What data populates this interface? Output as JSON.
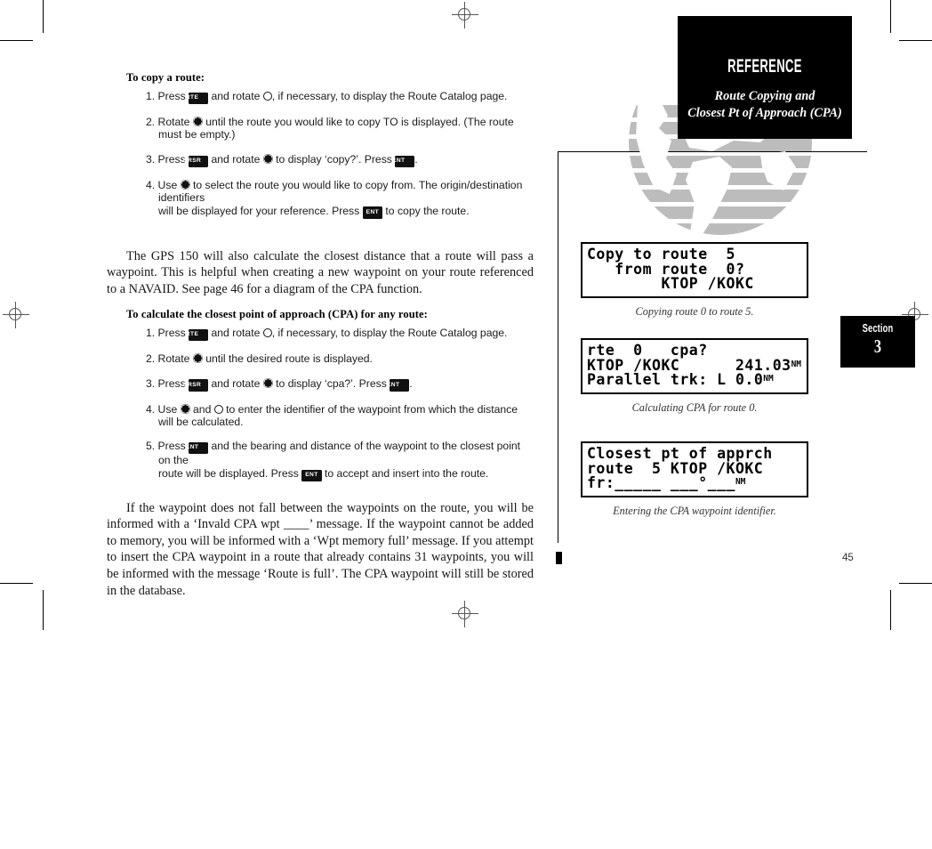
{
  "page": {
    "number": "45",
    "section_word": "Section",
    "section_number": "3"
  },
  "header": {
    "title": "REFERENCE",
    "subtitle_line1": "Route Copying and",
    "subtitle_line2": "Closest Pt of Approach (CPA)"
  },
  "left_column": {
    "heading1": "To copy a route:",
    "copy_steps": [
      {
        "num": "1. Press ",
        "key1": "RTE",
        "mid1": " and rotate ",
        "knob1": "small-knob",
        "mid2": ", if necessary, to display the Route Catalog page."
      },
      {
        "num": "2. Rotate ",
        "knob1": "large-knob",
        "mid1": " until the route you would like to copy TO is displayed.  (The route must be empty.)"
      },
      {
        "num": "3. Press ",
        "key1": "CRSR",
        "mid1": " and rotate ",
        "knob1": "large-knob",
        "mid2": " to display ‘copy?’.  Press ",
        "key2": "ENT",
        "mid3": "."
      },
      {
        "num": "4. Use ",
        "knob1": "large-knob",
        "mid1": " to select the route you would like to copy from. The origin/destination identifiers",
        "cont_pre": "will be displayed for your reference. Press ",
        "key2": "ENT",
        "cont_post": " to copy the route."
      }
    ],
    "paragraph1": "The GPS 150 will also calculate the closest distance that a route will pass a waypoint. This is helpful when creating a new waypoint on your route referenced to a NAVAID. See page 46 for a diagram of the CPA function.",
    "heading2": "To calculate the closest point of approach (CPA) for any route:",
    "cpa_steps": [
      {
        "num": "1. Press ",
        "key1": "RTE",
        "mid1": " and rotate ",
        "knob1": "small-knob",
        "mid2": ", if necessary, to display the Route Catalog page."
      },
      {
        "num": "2. Rotate ",
        "knob1": "large-knob",
        "mid1": " until the desired route is displayed."
      },
      {
        "num": "3. Press ",
        "key1": "CRSR",
        "mid1": " and rotate ",
        "knob1": "large-knob",
        "mid2": " to display ‘cpa?’.  Press ",
        "key2": "ENT",
        "mid3": "."
      },
      {
        "num": "4. Use ",
        "knob1": "large-knob",
        "mid1": " and ",
        "knob2": "small-knob",
        "mid2": " to enter the identifier of the waypoint from which the distance",
        "cont_pre": "will be calculated."
      },
      {
        "num": "5. Press ",
        "key1": "ENT",
        "mid1": " and the bearing and distance of the waypoint to the closest point on the",
        "cont_pre": "route will be displayed. Press ",
        "key2": "ENT",
        "cont_post": " to accept and insert into the route."
      }
    ],
    "paragraph2": "If the waypoint does not fall between the waypoints on the route, you will be informed with a ‘Invald CPA wpt ____’ message. If the waypoint cannot be added to memory, you will be informed with a ‘Wpt memory full’ message. If you attempt to insert the CPA waypoint in a route that already contains 31 waypoints, you will be informed with the message ‘Route is full’. The CPA waypoint will still be stored in the database."
  },
  "figures": [
    {
      "name": "copy-route-screen",
      "lines": [
        "Copy to route  5",
        "   from route  0?",
        "        KTOP /KOKC"
      ],
      "caption": "Copying route 0 to route 5."
    },
    {
      "name": "cpa-calc-screen",
      "lines": [
        "rte  0   cpa?",
        "KTOP /KOKC",
        "Parallel trk: L"
      ],
      "line2_value": "241.03",
      "line2_unit": "NM",
      "line3_value": "0.0",
      "line3_unit": "NM",
      "caption": "Calculating CPA for route 0."
    },
    {
      "name": "cpa-waypoint-entry-screen",
      "lines": [
        "Closest pt of apprch",
        "route  5 KTOP /KOKC",
        "fr:_____ ___°___"
      ],
      "line3_unit": "NM",
      "caption": "Entering the CPA waypoint identifier."
    }
  ]
}
